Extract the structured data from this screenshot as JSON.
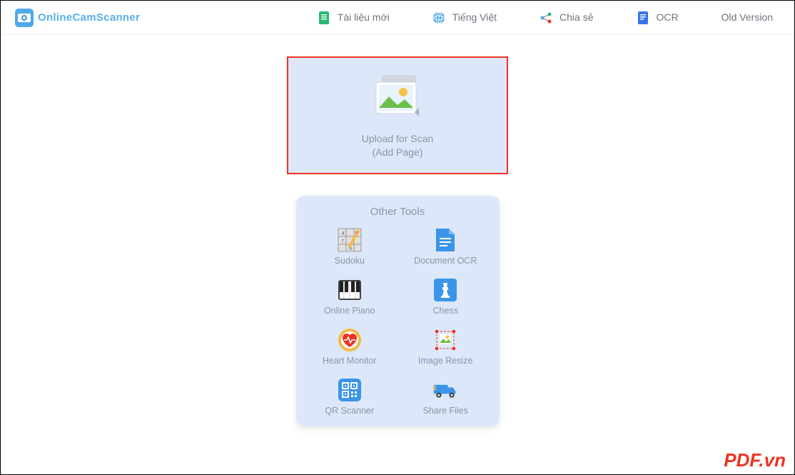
{
  "header": {
    "logo_text": "OnlineCamScanner",
    "nav": [
      {
        "label": "Tài liệu mới",
        "icon": "doc"
      },
      {
        "label": "Tiếng Việt",
        "icon": "globe"
      },
      {
        "label": "Chia sẻ",
        "icon": "share"
      },
      {
        "label": "OCR",
        "icon": "ocr"
      },
      {
        "label": "Old Version",
        "icon": ""
      }
    ]
  },
  "upload": {
    "line1": "Upload for Scan",
    "line2": "(Add Page)"
  },
  "tools": {
    "title": "Other Tools",
    "items": [
      {
        "label": "Sudoku",
        "icon": "sudoku"
      },
      {
        "label": "Document OCR",
        "icon": "docblue"
      },
      {
        "label": "Online Piano",
        "icon": "piano"
      },
      {
        "label": "Chess",
        "icon": "chess"
      },
      {
        "label": "Heart Monitor",
        "icon": "heart"
      },
      {
        "label": "Image Resize",
        "icon": "resize"
      },
      {
        "label": "QR Scanner",
        "icon": "qr"
      },
      {
        "label": "Share Files",
        "icon": "truck"
      }
    ]
  },
  "watermark": "PDF.vn"
}
